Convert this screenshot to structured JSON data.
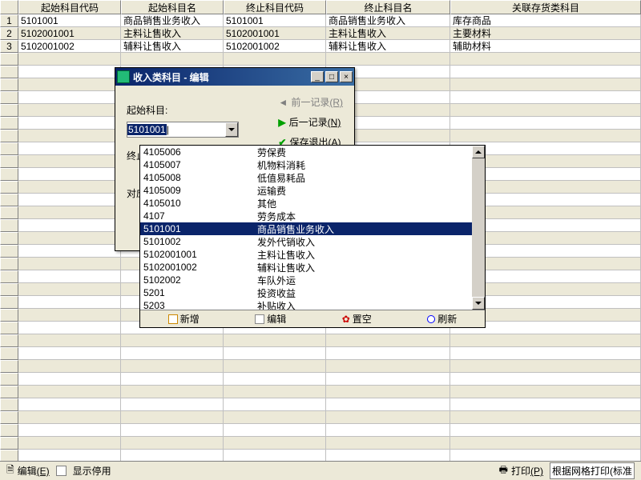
{
  "grid": {
    "headers": [
      "起始科目代码",
      "起始科目名",
      "终止科目代码",
      "终止科目名",
      "关联存货类科目"
    ],
    "rows": [
      {
        "num": "1",
        "c1": "5101001",
        "c2": "商品销售业务收入",
        "c3": "5101001",
        "c4": "商品销售业务收入",
        "c5": "库存商品"
      },
      {
        "num": "2",
        "c1": "5102001001",
        "c2": "主料让售收入",
        "c3": "5102001001",
        "c4": "主料让售收入",
        "c5": "主要材料"
      },
      {
        "num": "3",
        "c1": "5102001002",
        "c2": "辅料让售收入",
        "c3": "5102001002",
        "c4": "辅料让售收入",
        "c5": "辅助材料"
      }
    ]
  },
  "dialog": {
    "title": "收入类科目 - 编辑",
    "nav": {
      "prev": "前一记录",
      "prev_key": "(R)",
      "next": "后一记录",
      "next_key": "(N)",
      "save": "保存退出",
      "save_key": "(A)"
    },
    "fields": {
      "start_label": "起始科目:",
      "end_label": "终止科",
      "corr_label": "对应的"
    },
    "start_value_sel": "5101001"
  },
  "dropdown": {
    "items": [
      {
        "code": "4105006",
        "name": "劳保费"
      },
      {
        "code": "4105007",
        "name": "机物料消耗"
      },
      {
        "code": "4105008",
        "name": "低值易耗品"
      },
      {
        "code": "4105009",
        "name": "运输费"
      },
      {
        "code": "4105010",
        "name": "其他"
      },
      {
        "code": "4107",
        "name": "劳务成本"
      },
      {
        "code": "5101001",
        "name": "商品销售业务收入",
        "selected": true
      },
      {
        "code": "5101002",
        "name": "发外代销收入"
      },
      {
        "code": "5102001001",
        "name": "主料让售收入"
      },
      {
        "code": "5102001002",
        "name": "辅料让售收入"
      },
      {
        "code": "5102002",
        "name": "车队外运"
      },
      {
        "code": "5201",
        "name": "投资收益"
      },
      {
        "code": "5203",
        "name": "补贴收入"
      }
    ],
    "toolbar": {
      "new": "新增",
      "edit": "编辑",
      "clear": "置空",
      "refresh": "刷新"
    }
  },
  "bottombar": {
    "edit": "编辑",
    "edit_key": "(E)",
    "show_disabled": "显示停用",
    "print": "打印",
    "print_key": "(P)",
    "print_mode": "根据网格打印(标准"
  }
}
